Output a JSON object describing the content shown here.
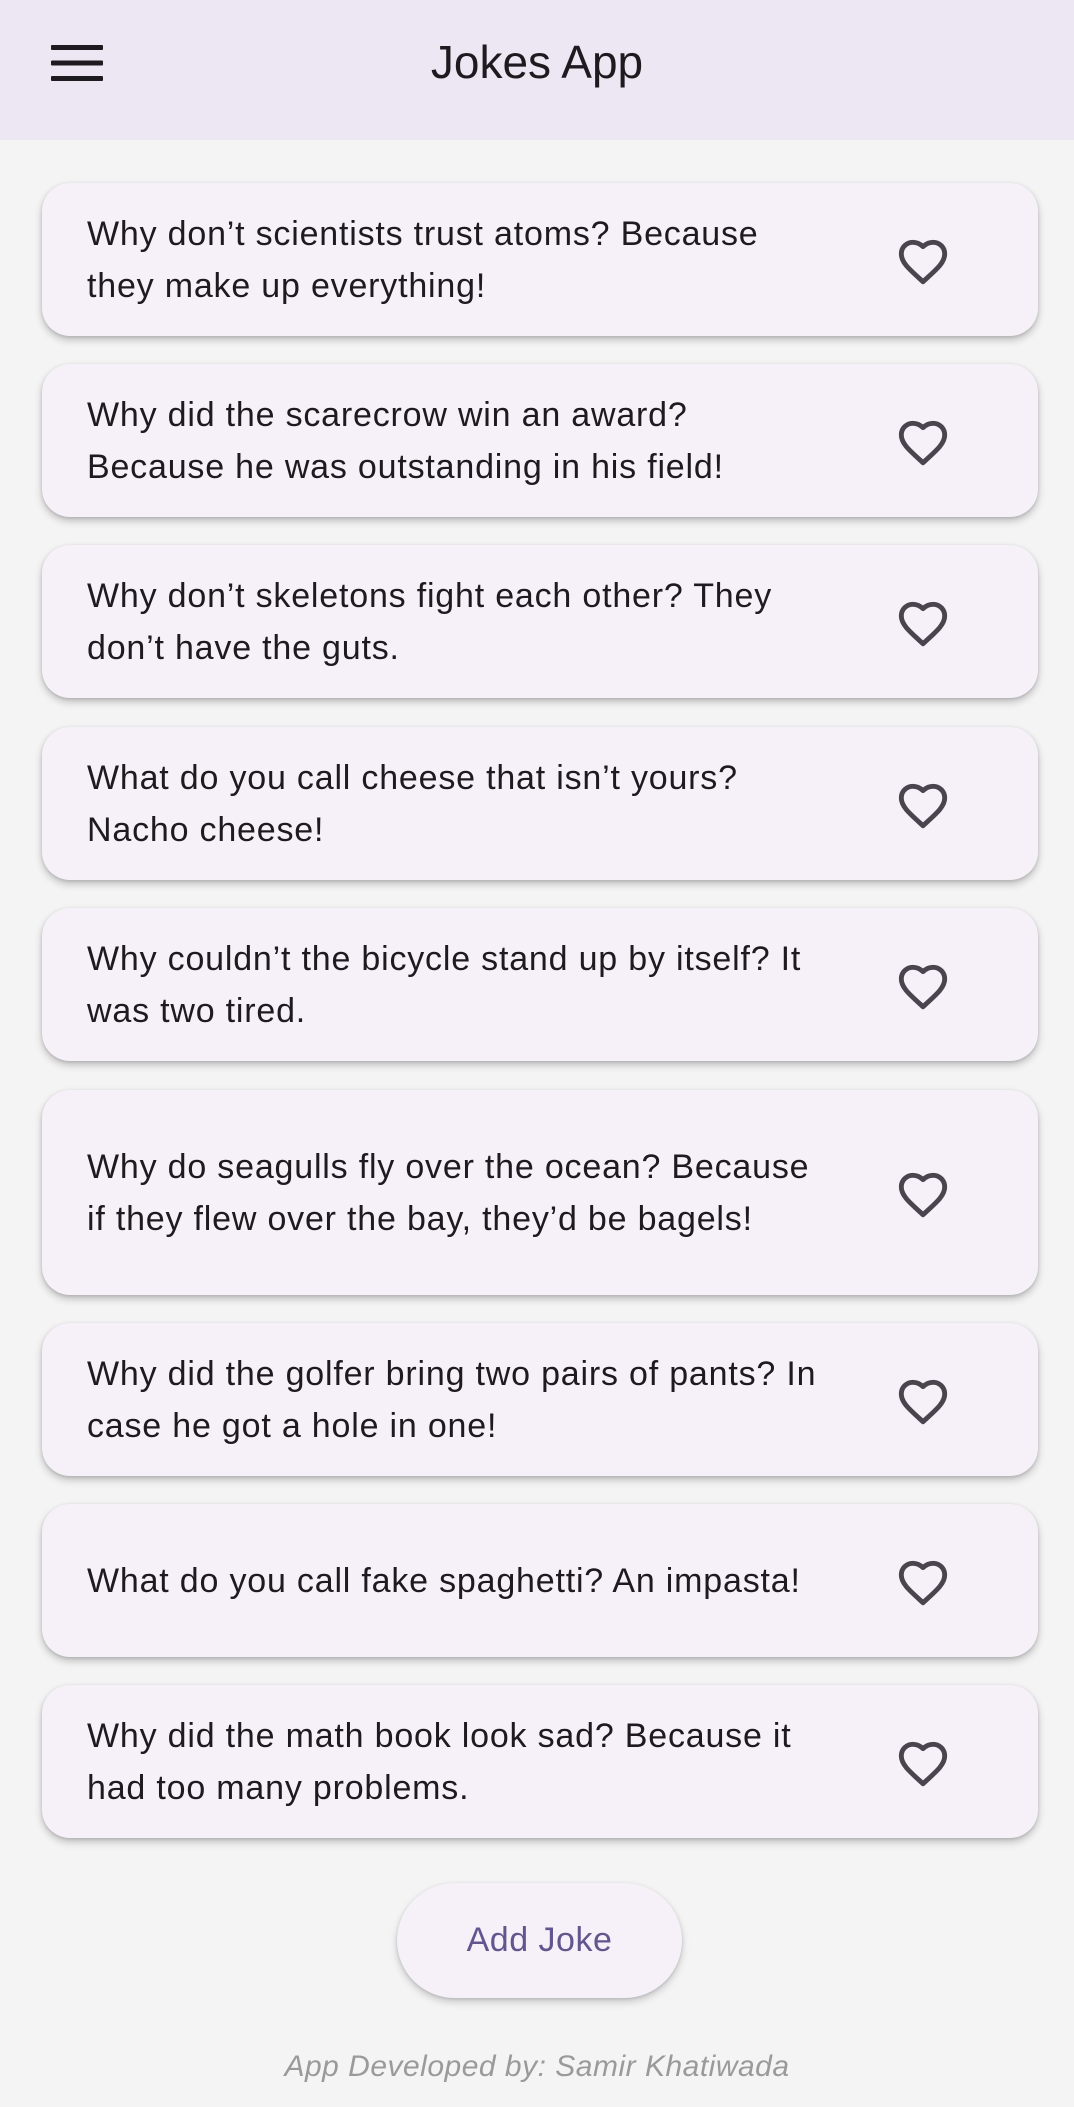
{
  "appbar": {
    "title": "Jokes App",
    "menu_icon": "menu-icon"
  },
  "jokes": [
    {
      "text": "Why don’t scientists trust atoms? Because they make up everything!",
      "favorite_icon": "heart-outline-icon"
    },
    {
      "text": "Why did the scarecrow win an award? Because he was outstanding in his field!",
      "favorite_icon": "heart-outline-icon"
    },
    {
      "text": "Why don’t skeletons fight each other? They don’t have the guts.",
      "favorite_icon": "heart-outline-icon"
    },
    {
      "text": "What do you call cheese that isn’t yours? Nacho cheese!",
      "favorite_icon": "heart-outline-icon"
    },
    {
      "text": "Why couldn’t the bicycle stand up by itself? It was two tired.",
      "favorite_icon": "heart-outline-icon"
    },
    {
      "text": "Why do seagulls fly over the ocean? Because if they flew over the bay, they’d be bagels!",
      "favorite_icon": "heart-outline-icon"
    },
    {
      "text": "Why did the golfer bring two pairs of pants? In case he got a hole in one!",
      "favorite_icon": "heart-outline-icon"
    },
    {
      "text": "What do you call fake spaghetti? An impasta!",
      "favorite_icon": "heart-outline-icon"
    },
    {
      "text": "Why did the math book look sad? Because it had too many problems.",
      "favorite_icon": "heart-outline-icon"
    }
  ],
  "add_button": {
    "label": "Add Joke"
  },
  "footer": {
    "text": "App Developed by: Samir Khatiwada"
  },
  "colors": {
    "appbar_bg": "#ede6f3",
    "page_bg": "#f4f4f4",
    "card_bg": "#f6f1f8",
    "accent": "#65558f",
    "icon": "#49454f"
  }
}
